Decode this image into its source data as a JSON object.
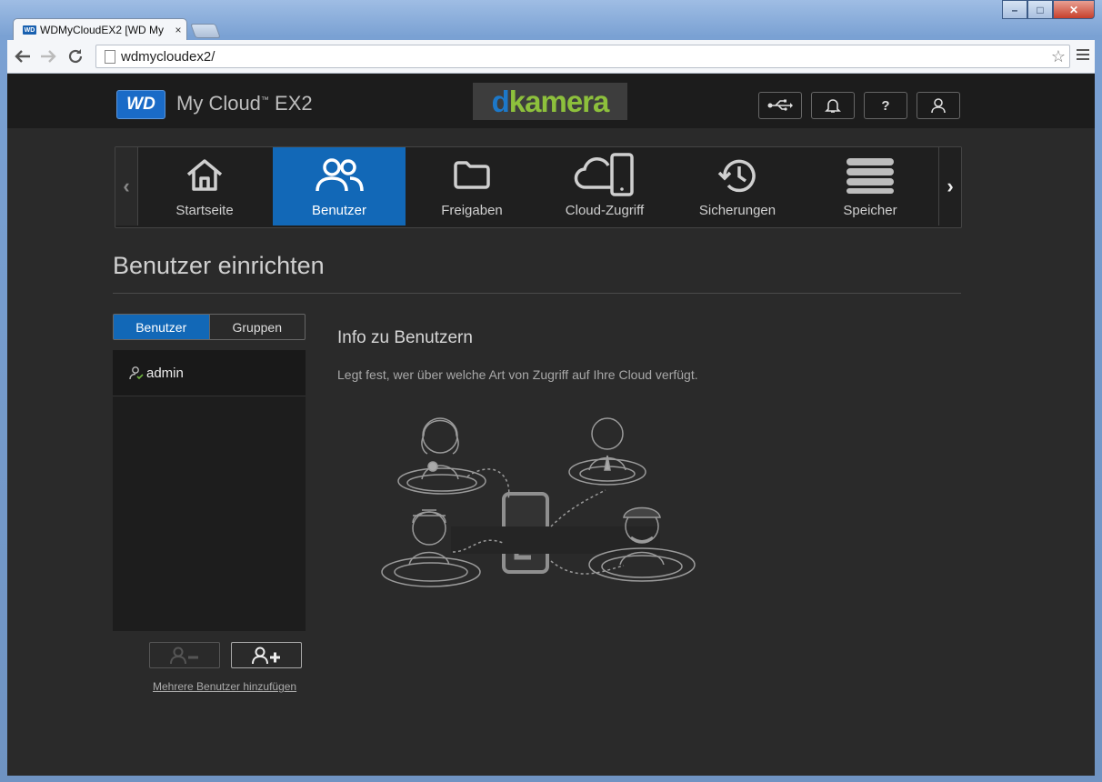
{
  "browser": {
    "tab_title": "WDMyCloudEX2 [WD My",
    "tab_favicon": "WD",
    "tab_close": "×",
    "url": "wdmycloudex2/"
  },
  "header": {
    "logo": "WD",
    "product": "My Cloud",
    "product_tm": "™",
    "product_model": " EX2",
    "watermark_prefix": "d",
    "watermark": "kamera",
    "help": "?"
  },
  "nav": {
    "items": [
      {
        "label": "Startseite"
      },
      {
        "label": "Benutzer"
      },
      {
        "label": "Freigaben"
      },
      {
        "label": "Cloud-Zugriff"
      },
      {
        "label": "Sicherungen"
      },
      {
        "label": "Speicher"
      }
    ],
    "active": "Benutzer"
  },
  "page": {
    "title": "Benutzer einrichten",
    "tabs": {
      "users": "Benutzer",
      "groups": "Gruppen"
    },
    "users": [
      {
        "name": "admin"
      }
    ],
    "add_multiple": "Mehrere Benutzer hinzufügen"
  },
  "info": {
    "title": "Info zu Benutzern",
    "description": "Legt fest, wer über welche Art von Zugriff auf Ihre Cloud verfügt."
  },
  "colors": {
    "accent": "#1268b7",
    "background": "#2a2a2a",
    "header": "#1c1c1c"
  }
}
